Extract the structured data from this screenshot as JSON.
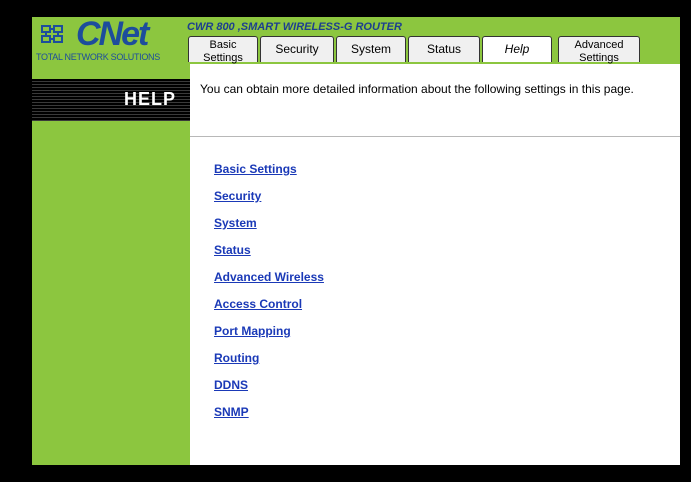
{
  "logo": {
    "brand": "CNet",
    "tagline": "TOTAL NETWORK SOLUTIONS",
    "brand_color": "#1d4d9c"
  },
  "header": {
    "product_title": "CWR 800 ,SMART WIRELESS-G ROUTER"
  },
  "tabs": [
    {
      "line1": "Basic",
      "line2": "Settings"
    },
    {
      "label": "Security"
    },
    {
      "label": "System"
    },
    {
      "label": "Status"
    },
    {
      "label": "Help",
      "active": true
    },
    {
      "line1": "Advanced",
      "line2": "Settings"
    }
  ],
  "sidebar": {
    "heading": "HELP"
  },
  "main": {
    "intro": "You can obtain more detailed information about the following settings in this page.",
    "links": [
      "Basic Settings",
      "Security",
      "System",
      "Status",
      "Advanced Wireless",
      "Access Control",
      "Port Mapping",
      "Routing",
      "DDNS",
      "SNMP"
    ]
  },
  "colors": {
    "frame_green": "#8cc63f",
    "link_blue": "#1a39b7",
    "background": "#000000"
  }
}
